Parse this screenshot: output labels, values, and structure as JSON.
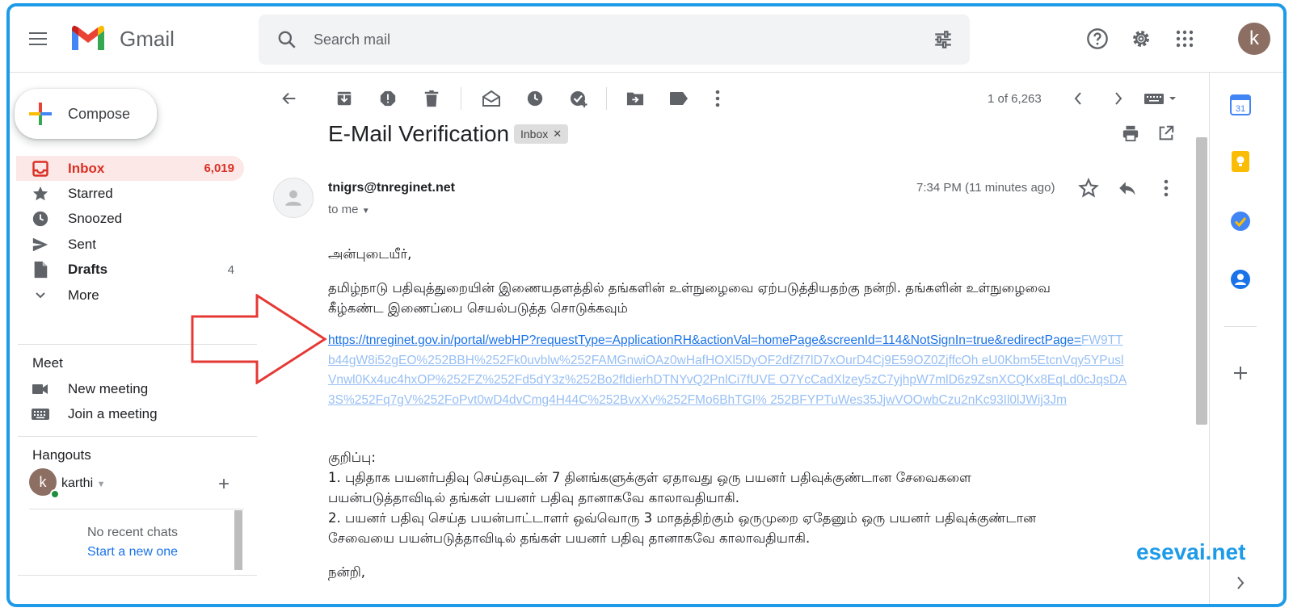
{
  "app": {
    "name": "Gmail"
  },
  "search": {
    "placeholder": "Search mail"
  },
  "user": {
    "initial": "k"
  },
  "compose": {
    "label": "Compose"
  },
  "nav": [
    {
      "label": "Inbox",
      "count": "6,019",
      "icon": "inbox-icon"
    },
    {
      "label": "Starred",
      "count": "",
      "icon": "star-icon"
    },
    {
      "label": "Snoozed",
      "count": "",
      "icon": "clock-icon"
    },
    {
      "label": "Sent",
      "count": "",
      "icon": "send-icon"
    },
    {
      "label": "Drafts",
      "count": "4",
      "icon": "draft-icon"
    },
    {
      "label": "More",
      "count": "",
      "icon": "chevron-down-icon"
    }
  ],
  "meet": {
    "title": "Meet",
    "new_meeting": "New meeting",
    "join_meeting": "Join a meeting"
  },
  "hangouts": {
    "title": "Hangouts",
    "contact_initial": "k",
    "contact_name": "karthi",
    "no_recent": "No recent chats",
    "start_new": "Start a new one"
  },
  "pager": {
    "text": "1 of 6,263"
  },
  "email": {
    "subject": "E-Mail Verification",
    "label_chip": "Inbox",
    "sender": "tnigrs@tnreginet.net",
    "recipient": "to me",
    "time": "7:34 PM (11 minutes ago)",
    "greeting": "அன்புடையீர்,",
    "para1_line1": "தமிழ்நாடு பதிவுத்துறையின் இணையதளத்தில் தங்களின் உள்நுழைவை ஏற்படுத்தியதற்கு நன்றி. தங்களின் உள்நுழைவை",
    "para1_line2": "கீழ்கண்ட இணைப்பை செயல்படுத்த சொடுக்கவும்",
    "link_line1": "https://tnreginet.gov.in/portal/webHP?requestType=ApplicationRH&actionVal=homePage&screenId=114&NotSignIn=true&redirectPage=",
    "link_rest": "FW9TTb44gW8i52gEO%252BBH%252Fk0uvblw%252FAMGnwiOAz0wHafHOXl5DyOF2dfZf7lD7xOurD4Cj9E59OZ0ZjffcOh eU0Kbm5EtcnVqy5YPuslVnwl0Kx4uc4hxOP%252FZ%252Fd5dY3z%252Bo2fldierhDTNYvQ2PnlCi7fUVE O7YcCadXlzey5zC7yjhpW7mlD6z9ZsnXCQKx8EqLd0cJqsDA3S%252Fq7gV%252FoPvt0wD4dvCmg4H44C%252BvxXv%252FMo6BhTGI% 252BFYPTuWes35JjwVOOwbCzu2nKc93Il0lJWij3Jm",
    "note_title": "குறிப்பு:",
    "note1_line1": "1. புதிதாக பயனர்பதிவு செய்தவுடன் 7 தினங்களுக்குள் ஏதாவது ஒரு பயனர் பதிவுக்குண்டான சேவைகளை",
    "note1_line2": "பயன்படுத்தாவிடில் தங்கள் பயனர் பதிவு தானாகவே காலாவதியாகி.",
    "note2_line1": "2. பயனர் பதிவு செய்த பயன்பாட்டாளர் ஒவ்வொரு 3 மாதத்திற்கும் ஒருமுறை ஏதேனும் ஒரு பயனர் பதிவுக்குண்டான",
    "note2_line2": "சேவையை பயன்படுத்தாவிடில் தங்கள் பயனர் பதிவு தானாகவே காலாவதியாகி.",
    "signoff": "நன்றி,"
  },
  "watermark": "esevai.net",
  "colors": {
    "accent_blue": "#1a73e8",
    "inbox_red": "#d93025",
    "frame_blue": "#1e9be8",
    "arrow_red": "#e53935"
  }
}
